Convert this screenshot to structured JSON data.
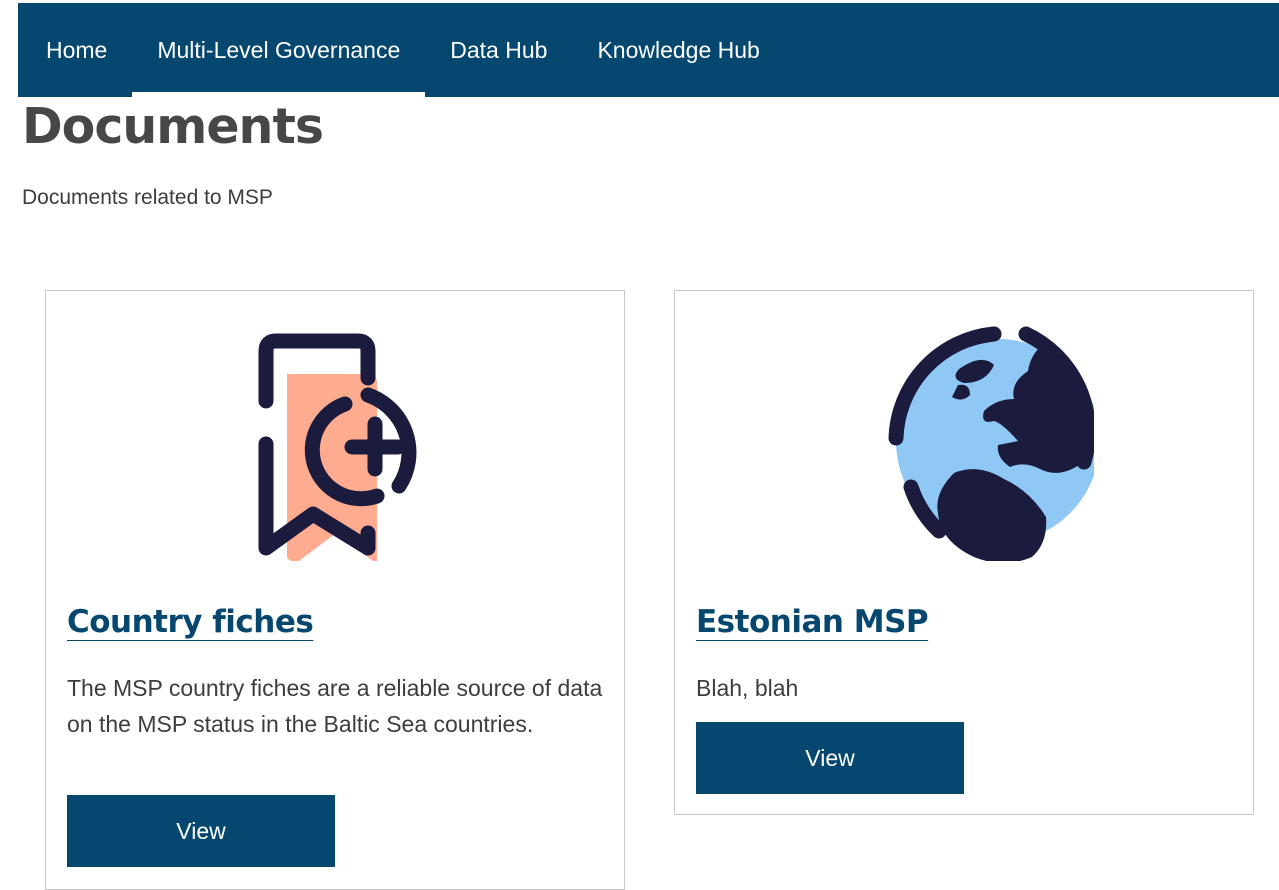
{
  "nav": {
    "items": [
      {
        "label": "Home"
      },
      {
        "label": "Multi-Level Governance"
      },
      {
        "label": "Data Hub"
      },
      {
        "label": "Knowledge Hub"
      }
    ],
    "active_index": 1
  },
  "page": {
    "title": "Documents",
    "subtitle": "Documents related to MSP"
  },
  "cards": [
    {
      "icon": "bookmark-plus-icon",
      "title": "Country fiches",
      "description": "The MSP country fiches are a reliable source of data on the MSP status in the Baltic Sea countries.",
      "button_label": "View"
    },
    {
      "icon": "globe-europe-icon",
      "title": "Estonian MSP",
      "description": "Blah, blah",
      "button_label": "View"
    }
  ],
  "colors": {
    "brand": "#05476e",
    "icon_dark": "#1a1b3d",
    "bookmark_fill": "#ffab90",
    "globe_fill": "#90c8f5"
  }
}
